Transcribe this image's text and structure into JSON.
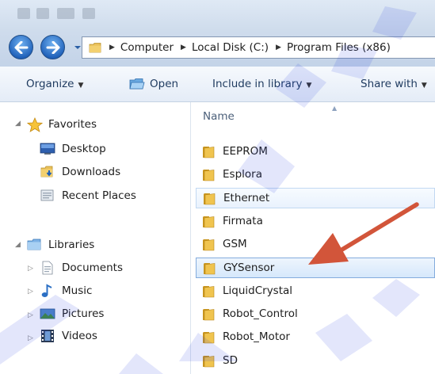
{
  "address": {
    "segments": [
      "Computer",
      "Local Disk (C:)",
      "Program Files (x86)"
    ]
  },
  "toolbar": {
    "organize": "Organize",
    "open": "Open",
    "include_in_library": "Include in library",
    "share_with": "Share with"
  },
  "nav": {
    "favorites": {
      "label": "Favorites",
      "items": [
        "Desktop",
        "Downloads",
        "Recent Places"
      ]
    },
    "libraries": {
      "label": "Libraries",
      "items": [
        "Documents",
        "Music",
        "Pictures",
        "Videos"
      ]
    }
  },
  "files": {
    "column_header": "Name",
    "items": [
      "EEPROM",
      "Esplora",
      "Ethernet",
      "Firmata",
      "GSM",
      "GYSensor",
      "LiquidCrystal",
      "Robot_Control",
      "Robot_Motor",
      "SD"
    ],
    "selected": "GYSensor"
  },
  "colors": {
    "annotation_arrow": "#d2553a",
    "watermark": "#2a3fe0"
  }
}
